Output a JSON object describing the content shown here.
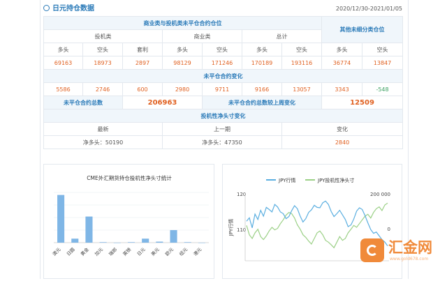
{
  "header": {
    "title": "日元持仓数据",
    "date_range": "2020/12/30-2021/01/05"
  },
  "table": {
    "group_title": "商业类与投机类未平仓合约仓位",
    "other_title": "其他未细分类仓位",
    "sub_groups": [
      "投机类",
      "商业类",
      "总计"
    ],
    "col_labels": [
      "多头",
      "空头",
      "套利",
      "多头",
      "空头",
      "多头",
      "空头",
      "多头",
      "空头"
    ],
    "positions": [
      "69163",
      "18973",
      "2897",
      "98129",
      "171246",
      "170189",
      "193116",
      "36774",
      "13847"
    ],
    "change_title": "未平仓合约变化",
    "changes": [
      "5586",
      "2746",
      "600",
      "2980",
      "9711",
      "9166",
      "13057",
      "3343",
      "-548"
    ],
    "total_label": "未平仓合约总数",
    "total_value": "206963",
    "weekly_change_label": "未平仓合约总数较上周变化",
    "weekly_change_value": "12509",
    "net_title": "投机性净头寸变化",
    "net_headers": [
      "最新",
      "上一期",
      "变化"
    ],
    "net_latest": "净多头：50190",
    "net_previous": "净多头：47350",
    "net_change": "2840"
  },
  "bar_chart": {
    "title": "CME外汇期货持仓投机性净头寸统计",
    "categories": [
      "澳元",
      "日圆",
      "黄金",
      "加元",
      "瑞郎",
      "英镑",
      "日元",
      "美元",
      "欧元",
      "纽元",
      "港元"
    ]
  },
  "line_chart": {
    "legend": [
      "JPY行情",
      "JPY投机性净头寸"
    ],
    "left_axis_label": "JPY行情",
    "left_ticks": [
      "120",
      "110"
    ],
    "right_ticks": [
      "200 000",
      "0"
    ]
  },
  "chart_data": [
    {
      "type": "bar",
      "title": "CME外汇期货持仓投机性净头寸统计",
      "categories": [
        "澳元",
        "日圆",
        "黄金",
        "加元",
        "瑞郎",
        "英镑",
        "日元",
        "美元",
        "欧元",
        "纽元",
        "港元"
      ],
      "values": [
        95,
        8,
        52,
        1,
        0,
        1,
        8,
        2,
        25,
        1,
        0
      ],
      "color": "#7fb6e6"
    },
    {
      "type": "line",
      "series": [
        {
          "name": "JPY行情",
          "color": "#5aaee0",
          "values": [
            109.8,
            110.6,
            108.2,
            111.5,
            110.2,
            112.4,
            111.0,
            113.1,
            112.6,
            112.0,
            113.8,
            113.2,
            112.0,
            111.6,
            110.4,
            110.9,
            112.3,
            113.5,
            112.8,
            111.0,
            109.6,
            110.4,
            111.9,
            112.5,
            113.6,
            113.1,
            113.0,
            114.2,
            114.6,
            113.8,
            112.1,
            110.9,
            111.6,
            112.4,
            111.3,
            110.2,
            108.5,
            108.9,
            110.3,
            112.2,
            113.0,
            112.6,
            111.1,
            109.4,
            107.8,
            106.9,
            107.2,
            106.3,
            105.4,
            104.8,
            103.9
          ]
        },
        {
          "name": "JPY投机性净头寸",
          "color": "#9bd086",
          "values": [
            -10,
            -35,
            -45,
            -30,
            -20,
            -40,
            -48,
            -38,
            -25,
            -15,
            -22,
            -18,
            -5,
            5,
            18,
            25,
            22,
            10,
            -8,
            -20,
            -35,
            -42,
            -52,
            -60,
            -45,
            -30,
            -25,
            -35,
            -50,
            -55,
            -62,
            -70,
            -55,
            -40,
            -50,
            -45,
            -30,
            -20,
            -10,
            -15,
            -5,
            5,
            15,
            20,
            10,
            25,
            35,
            40,
            30,
            45,
            50
          ]
        }
      ]
    }
  ]
}
